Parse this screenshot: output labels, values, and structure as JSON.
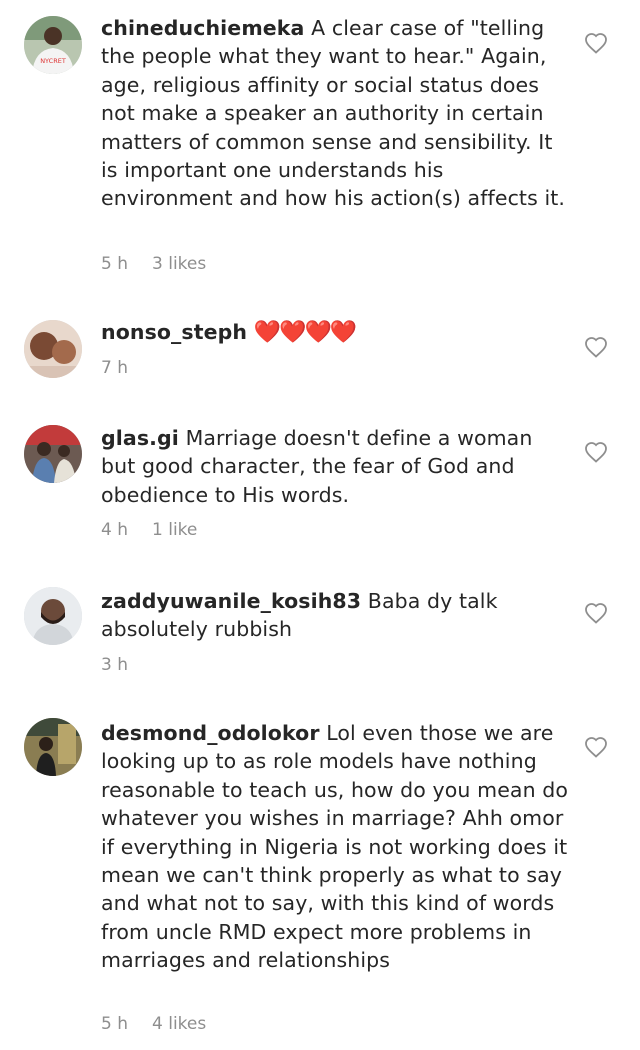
{
  "comments": [
    {
      "username": "chineduchiemeka",
      "text": "A clear case of \"telling the people what they want to hear.\" Again, age, religious affinity or social status does not make a speaker an authority in certain matters of common sense and sensibility. It is important one understands his environment and how his action(s) affects it.",
      "time": "5 h",
      "likes": "3 likes",
      "avatar_caption": "NYCRET"
    },
    {
      "username": "nonso_steph",
      "text": "❤️❤️❤️❤️",
      "time": "7 h",
      "likes": ""
    },
    {
      "username": "glas.gi",
      "text": "Marriage doesn't define a woman but good character, the fear of God and obedience to His words.",
      "time": "4 h",
      "likes": "1 like"
    },
    {
      "username": "zaddyuwanile_kosih83",
      "text": "Baba dy talk absolutely rubbish",
      "time": "3 h",
      "likes": ""
    },
    {
      "username": "desmond_odolokor",
      "text": "Lol even those we are looking up to as role models have nothing reasonable to teach us, how do you mean do whatever you wishes in marriage? Ahh omor if everything in Nigeria is not working does it mean we can't think properly as what to say and what not to say, with this kind of words from uncle RMD expect more problems in marriages and relationships",
      "time": "5 h",
      "likes": "4 likes"
    }
  ],
  "icons": {
    "like": "heart-outline-icon"
  },
  "colors": {
    "text": "#262626",
    "meta": "#8e8e8e",
    "heart_emoji": "#e0152c"
  }
}
